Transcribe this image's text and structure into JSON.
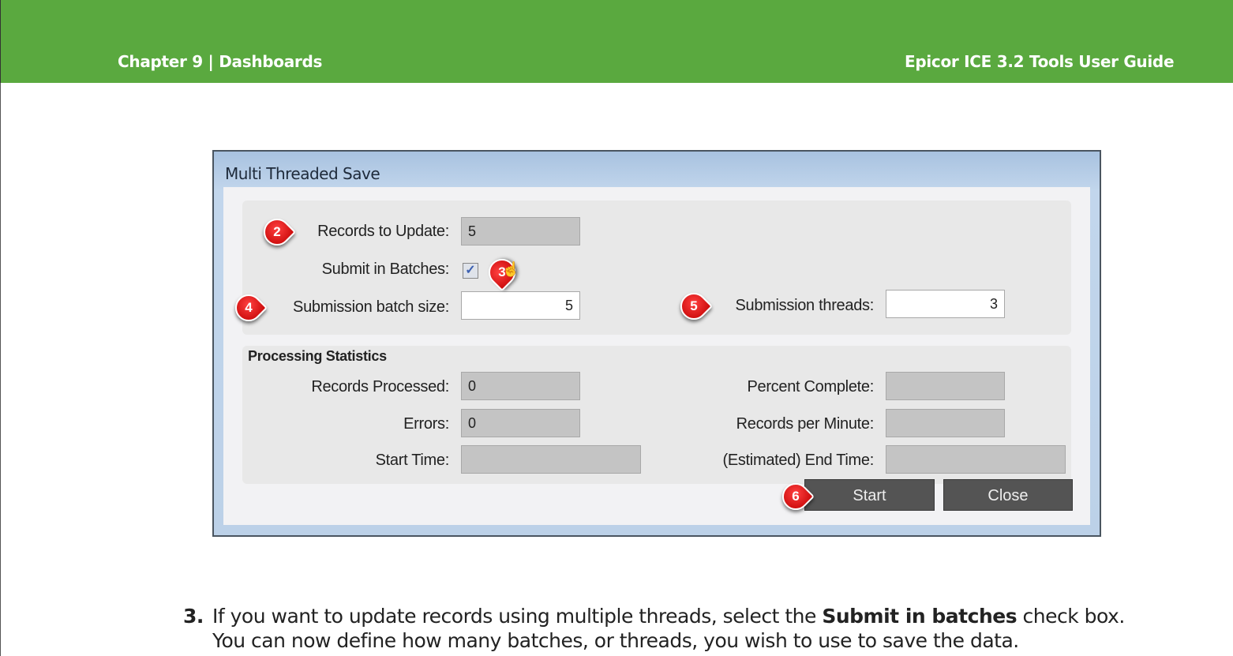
{
  "header": {
    "chapter": "Chapter 9 | Dashboards",
    "guide": "Epicor ICE 3.2 Tools User Guide"
  },
  "dialog": {
    "title": "Multi Threaded Save",
    "records_to_update": {
      "label": "Records to Update:",
      "value": "5"
    },
    "submit_in_batches": {
      "label": "Submit in Batches:",
      "checked": true,
      "check_glyph": "✓"
    },
    "batch_size": {
      "label": "Submission batch size:",
      "value": "5"
    },
    "threads": {
      "label": "Submission threads:",
      "value": "3"
    },
    "stats_title": "Processing Statistics",
    "records_processed": {
      "label": "Records Processed:",
      "value": "0"
    },
    "errors": {
      "label": "Errors:",
      "value": "0"
    },
    "start_time": {
      "label": "Start Time:",
      "value": ""
    },
    "percent_complete": {
      "label": "Percent Complete:",
      "value": ""
    },
    "records_per_minute": {
      "label": "Records per Minute:",
      "value": ""
    },
    "end_time": {
      "label": "(Estimated) End Time:",
      "value": ""
    },
    "start_button": "Start",
    "close_button": "Close"
  },
  "callouts": [
    "2",
    "3",
    "4",
    "5",
    "6"
  ],
  "step": {
    "number": "3.",
    "pre": "If you want to update records using multiple threads, select the ",
    "bold": "Submit in batches",
    "post": " check box. You can now define how many batches, or threads, you wish to use to save the data."
  }
}
